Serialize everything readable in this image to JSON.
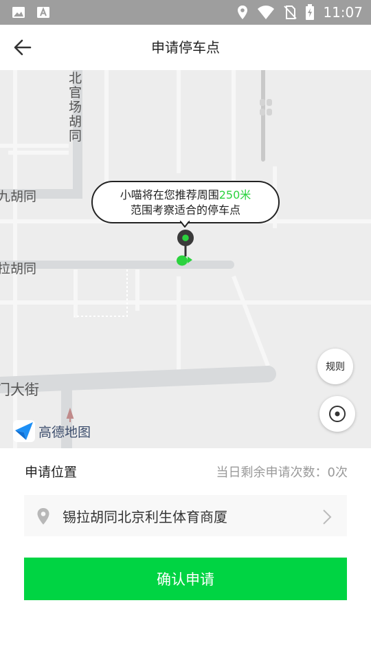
{
  "status_bar": {
    "time": "11:07",
    "icons": [
      "image-icon",
      "text-a-icon",
      "location-icon",
      "wifi-icon",
      "no-sim-icon",
      "battery-icon"
    ]
  },
  "app_bar": {
    "title": "申请停车点",
    "back_icon": "arrow-left-icon"
  },
  "map": {
    "streets": {
      "vertical": "北官场胡同",
      "left_upper": "九胡同",
      "left_middle": "拉胡同",
      "left_lower": "门大街"
    },
    "bubble": {
      "prefix": "小喵将在您推荐周围",
      "highlight": "250米",
      "line2": "范围考察适合的停车点"
    },
    "rules_label": "规则",
    "logo_text": "高德地图",
    "colors": {
      "highlight": "#2bd23e",
      "pin": "#2bd23e"
    }
  },
  "form": {
    "label": "申请位置",
    "remaining_text": "当日剩余申请次数：0次",
    "location_value": "锡拉胡同北京利生体育商厦"
  },
  "confirm_button": {
    "label": "确认申请",
    "color": "#00d443"
  }
}
